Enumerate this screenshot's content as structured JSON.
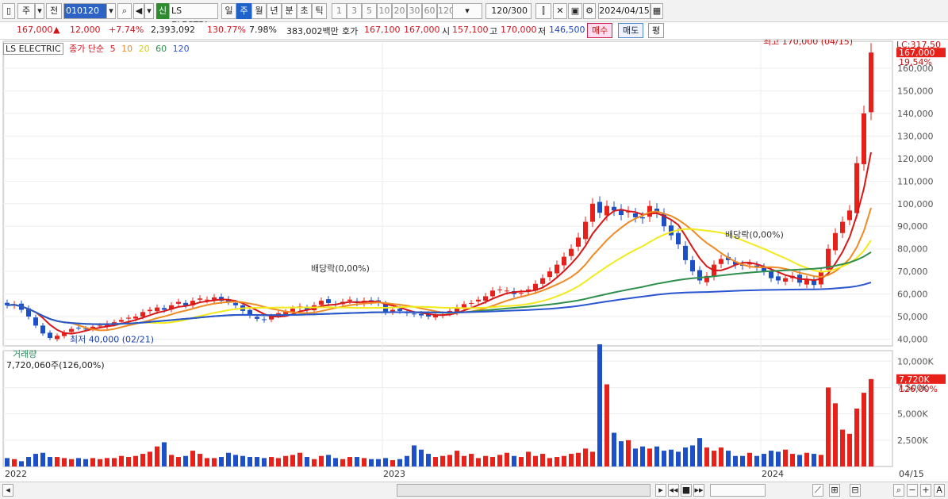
{
  "toolbar": {
    "period_sel": "주",
    "prev_btn": "전",
    "code": "010120",
    "badge": "신",
    "stock_name": "LS ELECTRI",
    "period_tabs": [
      "일",
      "주",
      "월",
      "년",
      "분",
      "초",
      "틱"
    ],
    "active_tab": "주",
    "nums": [
      "1",
      "3",
      "5",
      "10",
      "20",
      "30",
      "60",
      "120"
    ],
    "count": "120",
    "count_total": "/300",
    "date": "2024/04/15"
  },
  "info": {
    "price": "167,000",
    "arrow": "▲",
    "change": "12,000",
    "change_pct": "+7.74%",
    "volume": "2,393,092",
    "vol_ratio": "130.77%",
    "turnover": "7.98%",
    "amount": "383,002백만",
    "quote_label": "호가",
    "bid": "167,100",
    "ask": "167,000",
    "open_label": "시",
    "open": "157,100",
    "high_label": "고",
    "high": "170,000",
    "low_label": "저",
    "low": "146,500",
    "buy_btn": "매수",
    "sell_btn": "매도",
    "avg_btn": "평"
  },
  "legend": {
    "name": "LS ELECTRIC",
    "ma_label": "종가 단순",
    "ma": [
      "5",
      "10",
      "20",
      "60",
      "120"
    ]
  },
  "right_info": {
    "lc": "LC:317,50",
    "hc": "HC:1.32"
  },
  "volume_panel": {
    "title": "거래량",
    "value": "7,720,060주(126,00%)",
    "last_label": "7,720K",
    "last_pct": "126,00%"
  },
  "annotations": {
    "high": "최고 170,000 (04/15)",
    "low": "최저 40,000 (02/21)",
    "dividend1": "배당락(0,00%)",
    "dividend2": "배당락(0,00%)",
    "last_price": "167,000",
    "last_pct": "19,54%"
  },
  "colors": {
    "up": "#e8201a",
    "down": "#1c4fc8",
    "ma5": "#d81818",
    "ma10": "#f08a22",
    "ma20": "#f2ea1a",
    "ma60": "#2f8f4e",
    "ma120": "#2a55d0"
  },
  "chart_data": {
    "type": "candlestick",
    "title": "LS ELECTRIC",
    "ylim": [
      37000,
      172000
    ],
    "y_ticks": [
      "40,000",
      "50,000",
      "60,000",
      "70,000",
      "80,000",
      "90,000",
      "100,000",
      "110,000",
      "120,000",
      "130,000",
      "140,000",
      "150,000",
      "160,000"
    ],
    "y_tick_values": [
      40000,
      50000,
      60000,
      70000,
      80000,
      90000,
      100000,
      110000,
      120000,
      130000,
      140000,
      150000,
      160000
    ],
    "x_labels": [
      "2022",
      "2023",
      "2024"
    ],
    "x_label_index": [
      0,
      53,
      106
    ],
    "last_date": "04/15",
    "vol_ylim": [
      0,
      11000000
    ],
    "vol_ticks": [
      "2,500K",
      "5,000K",
      "7,500K",
      "10,000K"
    ],
    "vol_tick_values": [
      2500000,
      5000000,
      7500000,
      10000000
    ],
    "closes": [
      55000,
      55500,
      53000,
      50000,
      46000,
      42500,
      40500,
      41500,
      43000,
      44500,
      45000,
      44500,
      45500,
      46000,
      47000,
      47500,
      48500,
      49500,
      50000,
      52000,
      53000,
      54000,
      53000,
      55000,
      56500,
      55000,
      57000,
      58000,
      57500,
      58500,
      57000,
      56500,
      55000,
      52500,
      50500,
      49000,
      48500,
      50000,
      51500,
      52000,
      53500,
      54500,
      53000,
      55000,
      57000,
      56000,
      55500,
      56500,
      57500,
      56000,
      57000,
      56500,
      56000,
      52000,
      53000,
      52500,
      51500,
      51000,
      50500,
      50000,
      50500,
      51000,
      52500,
      54000,
      55500,
      56000,
      57500,
      59000,
      61500,
      62000,
      61500,
      60000,
      60500,
      62000,
      64500,
      67000,
      70000,
      73000,
      76500,
      80000,
      85000,
      92000,
      100000,
      96000,
      99000,
      97000,
      95000,
      96500,
      94000,
      93500,
      99000,
      96000,
      90000,
      86000,
      82000,
      75000,
      70000,
      66000,
      68000,
      73000,
      75500,
      75000,
      73000,
      72500,
      73500,
      72000,
      70000,
      67000,
      66000,
      67000,
      68000,
      65000,
      66500,
      64000,
      70000,
      80000,
      87000,
      92000,
      97000,
      118000,
      140000,
      167000
    ],
    "volumes": [
      800000,
      700000,
      500000,
      900000,
      1200000,
      1300000,
      900000,
      900000,
      800000,
      700000,
      800000,
      700000,
      800000,
      700000,
      800000,
      800000,
      1000000,
      900000,
      1000000,
      1200000,
      1400000,
      1900000,
      2300000,
      1100000,
      900000,
      1000000,
      1500000,
      1200000,
      800000,
      800000,
      900000,
      1300000,
      1100000,
      1000000,
      900000,
      900000,
      800000,
      900000,
      800000,
      1000000,
      1100000,
      1300000,
      900000,
      700000,
      1000000,
      1100000,
      800000,
      700000,
      900000,
      900000,
      800000,
      700000,
      700000,
      800000,
      600000,
      700000,
      1000000,
      2000000,
      1600000,
      1200000,
      900000,
      1000000,
      1100000,
      1500000,
      1000000,
      1200000,
      800000,
      1000000,
      900000,
      1100000,
      1300000,
      1000000,
      900000,
      1400000,
      1000000,
      1200000,
      800000,
      900000,
      1000000,
      1200000,
      1300000,
      1700000,
      1400000,
      11600000,
      7800000,
      3200000,
      2400000,
      2500000,
      1700000,
      1900000,
      1700000,
      1900000,
      1500000,
      1600000,
      1400000,
      1800000,
      2000000,
      2700000,
      1800000,
      1500000,
      1800000,
      1500000,
      1000000,
      1000000,
      1300000,
      1000000,
      1200000,
      1500000,
      1400000,
      1600000,
      1200000,
      1100000,
      1300000,
      1200000,
      1100000,
      7500000,
      6000000,
      3500000,
      3100000,
      5500000,
      7000000,
      8300000
    ]
  }
}
